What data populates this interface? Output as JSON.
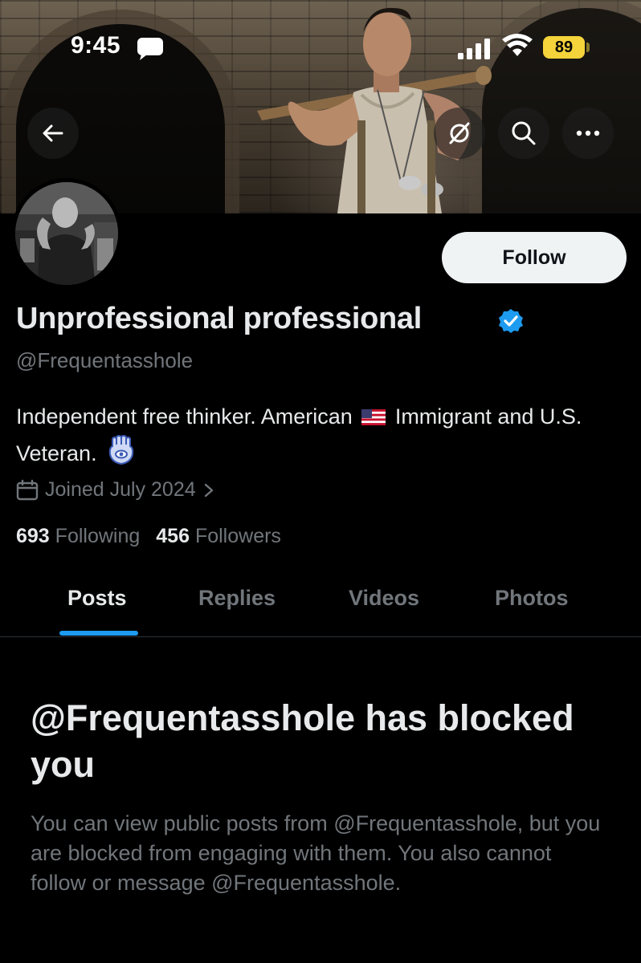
{
  "status_bar": {
    "time": "9:45",
    "battery": "89",
    "icons": [
      "message-icon",
      "signal-icon",
      "wifi-icon",
      "battery-icon"
    ]
  },
  "nav": {
    "icons": [
      "back-arrow-icon",
      "grok-icon",
      "search-icon",
      "more-icon"
    ]
  },
  "profile": {
    "display_name": "Unprofessional professional",
    "handle": "@Frequentasshole",
    "bio_part1": "Independent free thinker. American",
    "bio_part2": "Immigrant and U.S. Veteran.",
    "joined": "Joined July 2024",
    "following_count": "693",
    "following_label": "Following",
    "followers_count": "456",
    "followers_label": "Followers",
    "follow_button": "Follow"
  },
  "tabs": [
    {
      "label": "Posts",
      "active": true
    },
    {
      "label": "Replies",
      "active": false
    },
    {
      "label": "Videos",
      "active": false
    },
    {
      "label": "Photos",
      "active": false
    }
  ],
  "blocked": {
    "title": "@Frequentasshole has blocked you",
    "description": "You can view public posts from @Frequentasshole, but you are blocked from engaging with them. You also cannot follow or message @Frequentasshole."
  },
  "colors": {
    "background": "#000000",
    "primary_text": "#e7e9ea",
    "secondary_text": "#71767b",
    "accent": "#1d9bf0",
    "battery": "#f4d33b",
    "follow_bg": "#eff3f4"
  }
}
